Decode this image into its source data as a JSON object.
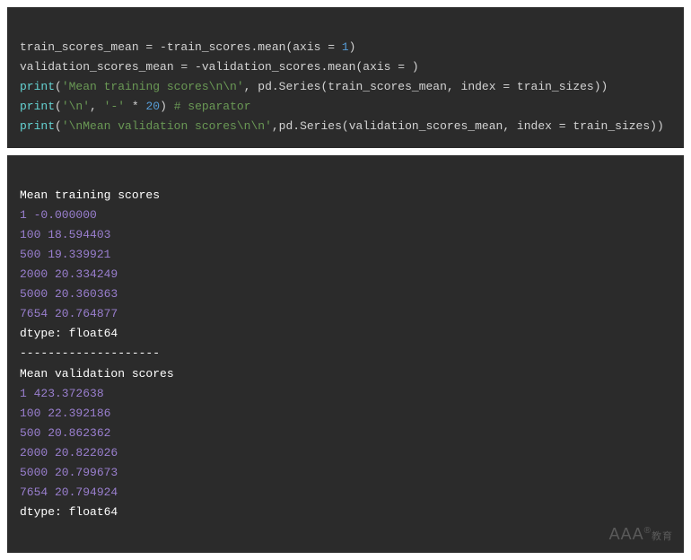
{
  "code": {
    "line1": {
      "a": "train_scores_mean = -train_scores.mean(axis = ",
      "num": "1",
      "b": ")"
    },
    "line2": {
      "a": "validation_scores_mean = -validation_scores.mean(axis = )"
    },
    "line3": {
      "fn": "print",
      "paren1": "(",
      "str": "'Mean training scores\\n\\n'",
      "mid": ", pd.Series(train_scores_mean, index = train_sizes))"
    },
    "line4": {
      "fn": "print",
      "paren1": "(",
      "str1": "'\\n'",
      "comma": ", ",
      "str2": "'-'",
      "mul": " * ",
      "num": "20",
      "close": ") ",
      "comment": "# separator"
    },
    "line5": {
      "fn": "print",
      "paren1": "(",
      "str": "'\\nMean validation scores\\n\\n'",
      "mid": ",pd.Series(validation_scores_mean, index = train_sizes))"
    }
  },
  "output": {
    "header1": "Mean training scores",
    "train_rows": [
      "1 -0.000000",
      "100 18.594403",
      "500 19.339921",
      "2000 20.334249",
      "5000 20.360363",
      "7654 20.764877"
    ],
    "dtype1": "dtype: float64",
    "sep": "--------------------",
    "header2": "Mean validation scores",
    "val_rows": [
      "1 423.372638",
      "100 22.392186",
      "500 20.862362",
      "2000 20.822026",
      "5000 20.799673",
      "7654 20.794924"
    ],
    "dtype2": "dtype: float64"
  },
  "watermark": {
    "text": "AAA",
    "reg": "®",
    "sub": "教育"
  }
}
